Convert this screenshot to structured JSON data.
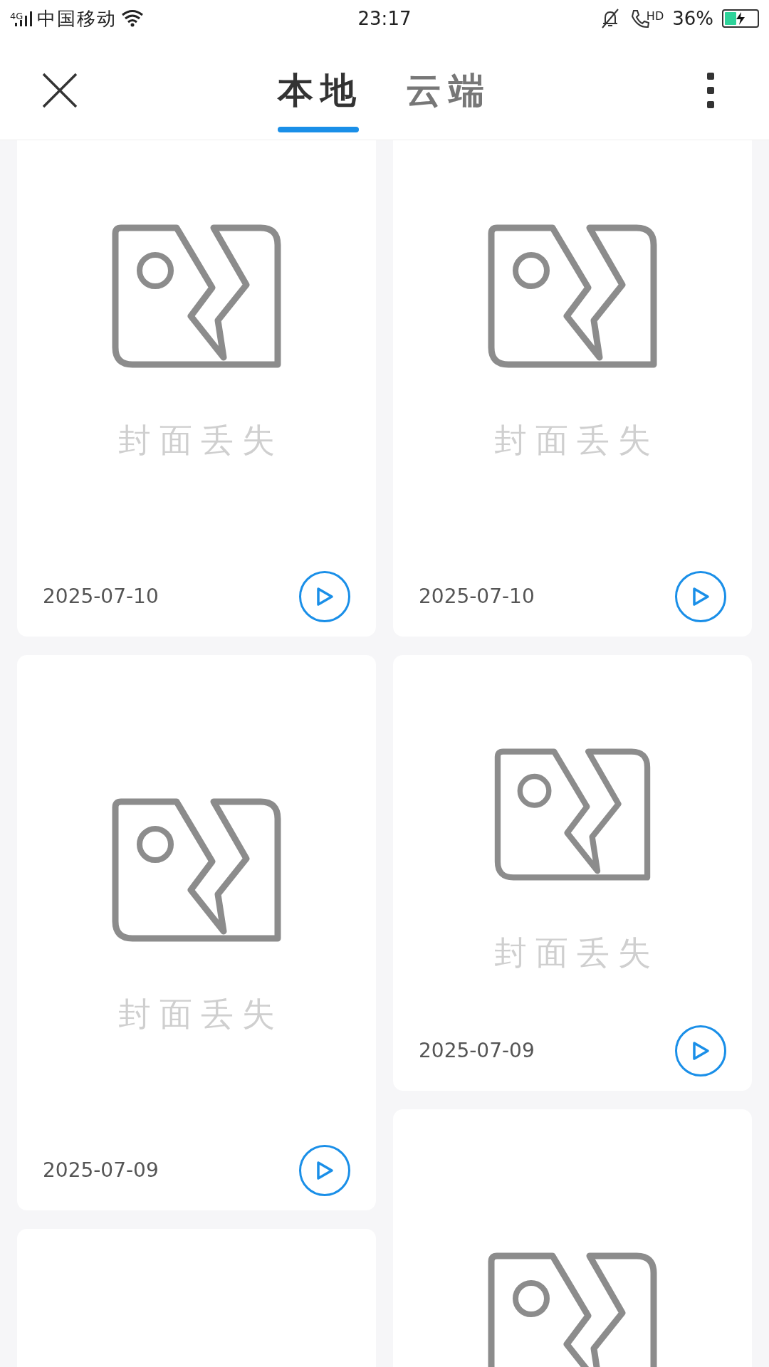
{
  "status_bar": {
    "network": "4G",
    "carrier": "中国移动",
    "time": "23:17",
    "hd": "HD",
    "battery": "36%"
  },
  "tabs": [
    {
      "label": "本地",
      "selected": true
    },
    {
      "label": "云端",
      "selected": false
    }
  ],
  "columns": [
    [
      {
        "kind": "tall",
        "icon": true,
        "label": "封面丢失",
        "date": "2025-07-10"
      },
      {
        "kind": "tall",
        "icon": true,
        "label": "封面丢失",
        "date": "2025-07-09"
      },
      {
        "kind": "tall",
        "icon": false
      }
    ],
    [
      {
        "kind": "tall",
        "icon": true,
        "label": "封面丢失",
        "date": "2025-07-10"
      },
      {
        "kind": "short",
        "icon": true,
        "label": "封面丢失",
        "date": "2025-07-09"
      },
      {
        "kind": "tall",
        "icon": true
      }
    ]
  ]
}
